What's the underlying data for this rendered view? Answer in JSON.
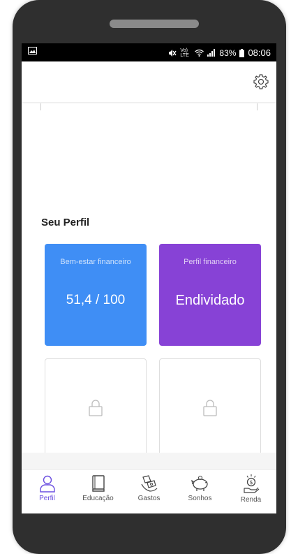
{
  "status_bar": {
    "signal_text": "Vo) LTE",
    "battery": "83%",
    "time": "08:06"
  },
  "app_bar": {
    "settings_icon": "gear-icon"
  },
  "profile": {
    "section_title": "Seu Perfil",
    "cards": [
      {
        "label": "Bem-estar financeiro",
        "value": "51,4 / 100",
        "color": "#3f8ef5"
      },
      {
        "label": "Perfil financeiro",
        "value": "Endividado",
        "color": "#8742d6"
      }
    ],
    "locked_cards": [
      {
        "icon": "lock-icon"
      },
      {
        "icon": "lock-icon"
      }
    ]
  },
  "bottom_nav": {
    "accent_color": "#6a4ee0",
    "items": [
      {
        "label": "Perfil",
        "icon": "user-icon",
        "active": true
      },
      {
        "label": "Educação",
        "icon": "book-icon",
        "active": false
      },
      {
        "label": "Gastos",
        "icon": "money-icon",
        "active": false
      },
      {
        "label": "Sonhos",
        "icon": "piggy-bank-icon",
        "active": false
      },
      {
        "label": "Renda",
        "icon": "income-icon",
        "active": false
      }
    ]
  }
}
